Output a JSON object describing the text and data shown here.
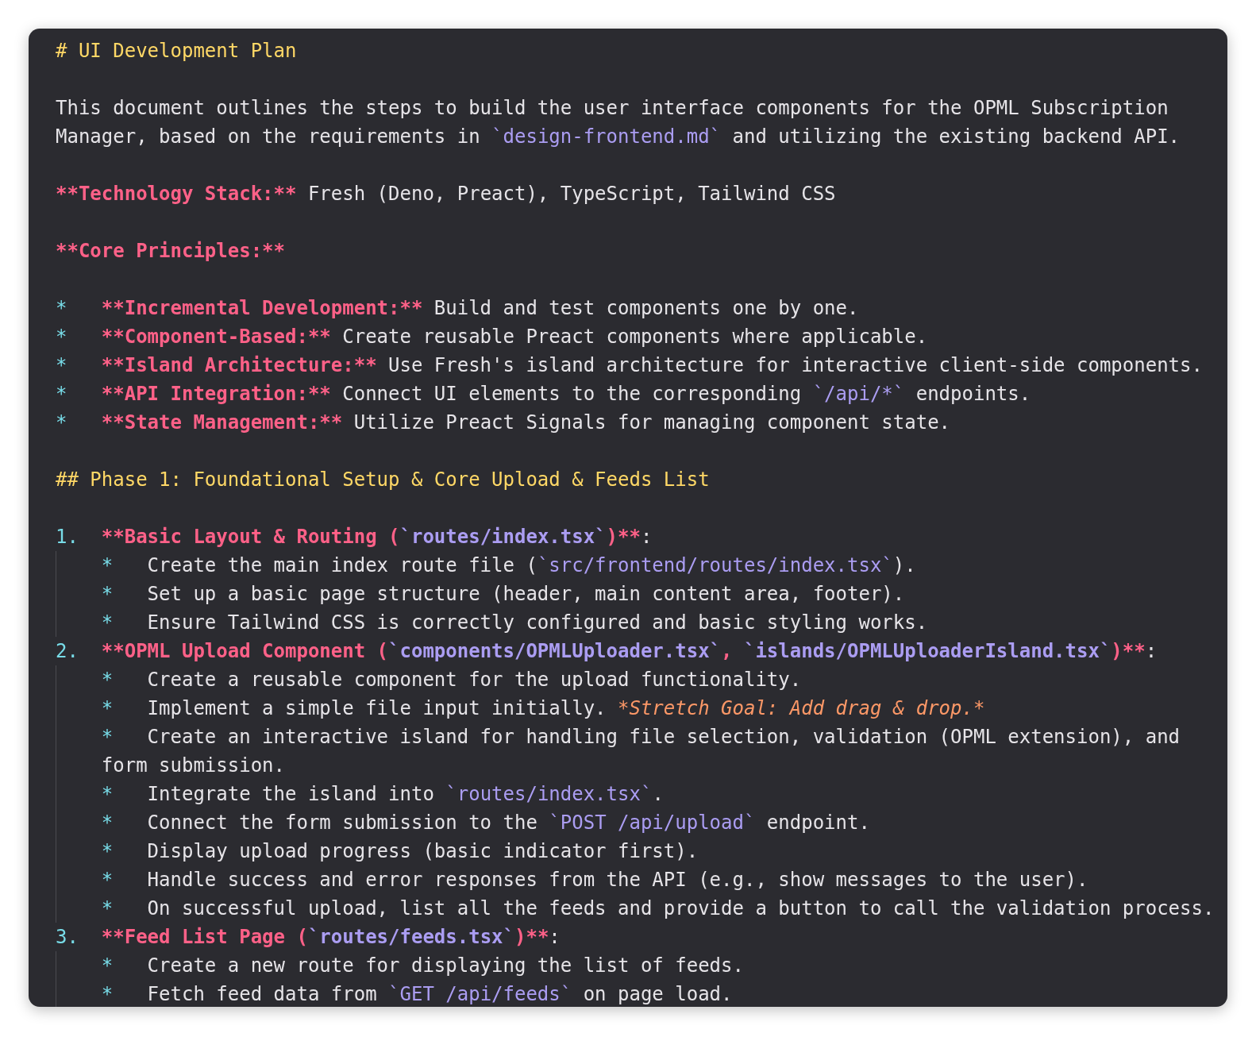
{
  "editor": {
    "lines": [
      {
        "space_before": false,
        "indented": false,
        "spans": [
          {
            "kind": "heading",
            "text": "# UI Development Plan"
          }
        ]
      },
      {
        "space_before": true,
        "indented": false,
        "spans": [
          {
            "kind": "text",
            "text": "This document outlines the steps to build the user interface components for the OPML Subscription"
          }
        ]
      },
      {
        "space_before": false,
        "indented": false,
        "spans": [
          {
            "kind": "text",
            "text": "Manager, based on the requirements in "
          },
          {
            "kind": "code",
            "text": "`design-frontend.md`"
          },
          {
            "kind": "text",
            "text": " and utilizing the existing backend API."
          }
        ]
      },
      {
        "space_before": true,
        "indented": false,
        "spans": [
          {
            "kind": "bold",
            "text": "**Technology Stack:**"
          },
          {
            "kind": "text",
            "text": " Fresh (Deno, Preact), TypeScript, Tailwind CSS"
          }
        ]
      },
      {
        "space_before": true,
        "indented": false,
        "spans": [
          {
            "kind": "bold",
            "text": "**Core Principles:**"
          }
        ]
      },
      {
        "space_before": true,
        "indented": false,
        "marker": "*",
        "spans": [
          {
            "kind": "bold",
            "text": "**Incremental Development:**"
          },
          {
            "kind": "text",
            "text": " Build and test components one by one."
          }
        ]
      },
      {
        "space_before": false,
        "indented": false,
        "marker": "*",
        "spans": [
          {
            "kind": "bold",
            "text": "**Component-Based:**"
          },
          {
            "kind": "text",
            "text": " Create reusable Preact components where applicable."
          }
        ]
      },
      {
        "space_before": false,
        "indented": false,
        "marker": "*",
        "spans": [
          {
            "kind": "bold",
            "text": "**Island Architecture:**"
          },
          {
            "kind": "text",
            "text": " Use Fresh's island architecture for interactive client-side components."
          }
        ]
      },
      {
        "space_before": false,
        "indented": false,
        "marker": "*",
        "spans": [
          {
            "kind": "bold",
            "text": "**API Integration:**"
          },
          {
            "kind": "text",
            "text": " Connect UI elements to the corresponding "
          },
          {
            "kind": "code",
            "text": "`/api/*`"
          },
          {
            "kind": "text",
            "text": " endpoints."
          }
        ]
      },
      {
        "space_before": false,
        "indented": false,
        "marker": "*",
        "spans": [
          {
            "kind": "bold",
            "text": "**State Management:**"
          },
          {
            "kind": "text",
            "text": " Utilize Preact Signals for managing component state."
          }
        ]
      },
      {
        "space_before": true,
        "indented": false,
        "spans": [
          {
            "kind": "heading",
            "text": "## Phase 1: Foundational Setup & Core Upload & Feeds List"
          }
        ]
      },
      {
        "space_before": true,
        "indented": false,
        "marker": "1.",
        "spans": [
          {
            "kind": "bold",
            "text": "**Basic Layout & Routing ("
          },
          {
            "kind": "bold_code",
            "text": "`routes/index.tsx`"
          },
          {
            "kind": "bold",
            "text": ")**"
          },
          {
            "kind": "text",
            "text": ":"
          }
        ]
      },
      {
        "space_before": false,
        "indented": true,
        "marker": "*",
        "spans": [
          {
            "kind": "text",
            "text": "Create the main index route file ("
          },
          {
            "kind": "code",
            "text": "`src/frontend/routes/index.tsx`"
          },
          {
            "kind": "text",
            "text": ")."
          }
        ]
      },
      {
        "space_before": false,
        "indented": true,
        "marker": "*",
        "spans": [
          {
            "kind": "text",
            "text": "Set up a basic page structure (header, main content area, footer)."
          }
        ]
      },
      {
        "space_before": false,
        "indented": true,
        "marker": "*",
        "spans": [
          {
            "kind": "text",
            "text": "Ensure Tailwind CSS is correctly configured and basic styling works."
          }
        ]
      },
      {
        "space_before": false,
        "indented": false,
        "marker": "2.",
        "spans": [
          {
            "kind": "bold",
            "text": "**OPML Upload Component ("
          },
          {
            "kind": "bold_code",
            "text": "`components/OPMLUploader.tsx`"
          },
          {
            "kind": "bold",
            "text": ", "
          },
          {
            "kind": "bold_code",
            "text": "`islands/OPMLUploaderIsland.tsx`"
          },
          {
            "kind": "bold",
            "text": ")**"
          },
          {
            "kind": "text",
            "text": ":"
          }
        ]
      },
      {
        "space_before": false,
        "indented": true,
        "marker": "*",
        "spans": [
          {
            "kind": "text",
            "text": "Create a reusable component for the upload functionality."
          }
        ]
      },
      {
        "space_before": false,
        "indented": true,
        "marker": "*",
        "spans": [
          {
            "kind": "text",
            "text": "Implement a simple file input initially. "
          },
          {
            "kind": "italic",
            "text": "*Stretch Goal: Add drag & drop.*"
          }
        ]
      },
      {
        "space_before": false,
        "indented": true,
        "marker": "*",
        "spans": [
          {
            "kind": "text",
            "text": "Create an interactive island for handling file selection, validation (OPML extension), and"
          }
        ]
      },
      {
        "space_before": false,
        "indented": true,
        "spans": [
          {
            "kind": "text",
            "text": "form submission."
          }
        ]
      },
      {
        "space_before": false,
        "indented": true,
        "marker": "*",
        "spans": [
          {
            "kind": "text",
            "text": "Integrate the island into "
          },
          {
            "kind": "code",
            "text": "`routes/index.tsx`"
          },
          {
            "kind": "text",
            "text": "."
          }
        ]
      },
      {
        "space_before": false,
        "indented": true,
        "marker": "*",
        "spans": [
          {
            "kind": "text",
            "text": "Connect the form submission to the "
          },
          {
            "kind": "code",
            "text": "`POST /api/upload`"
          },
          {
            "kind": "text",
            "text": " endpoint."
          }
        ]
      },
      {
        "space_before": false,
        "indented": true,
        "marker": "*",
        "spans": [
          {
            "kind": "text",
            "text": "Display upload progress (basic indicator first)."
          }
        ]
      },
      {
        "space_before": false,
        "indented": true,
        "marker": "*",
        "spans": [
          {
            "kind": "text",
            "text": "Handle success and error responses from the API (e.g., show messages to the user)."
          }
        ]
      },
      {
        "space_before": false,
        "indented": true,
        "marker": "*",
        "spans": [
          {
            "kind": "text",
            "text": "On successful upload, list all the feeds and provide a button to call the validation process."
          }
        ]
      },
      {
        "space_before": false,
        "indented": false,
        "marker": "3.",
        "spans": [
          {
            "kind": "bold",
            "text": "**Feed List Page ("
          },
          {
            "kind": "bold_code",
            "text": "`routes/feeds.tsx`"
          },
          {
            "kind": "bold",
            "text": ")**"
          },
          {
            "kind": "text",
            "text": ":"
          }
        ]
      },
      {
        "space_before": false,
        "indented": true,
        "marker": "*",
        "spans": [
          {
            "kind": "text",
            "text": "Create a new route for displaying the list of feeds."
          }
        ]
      },
      {
        "space_before": false,
        "indented": true,
        "marker": "*",
        "spans": [
          {
            "kind": "text",
            "text": "Fetch feed data from "
          },
          {
            "kind": "code",
            "text": "`GET /api/feeds`"
          },
          {
            "kind": "text",
            "text": " on page load."
          }
        ]
      }
    ]
  }
}
